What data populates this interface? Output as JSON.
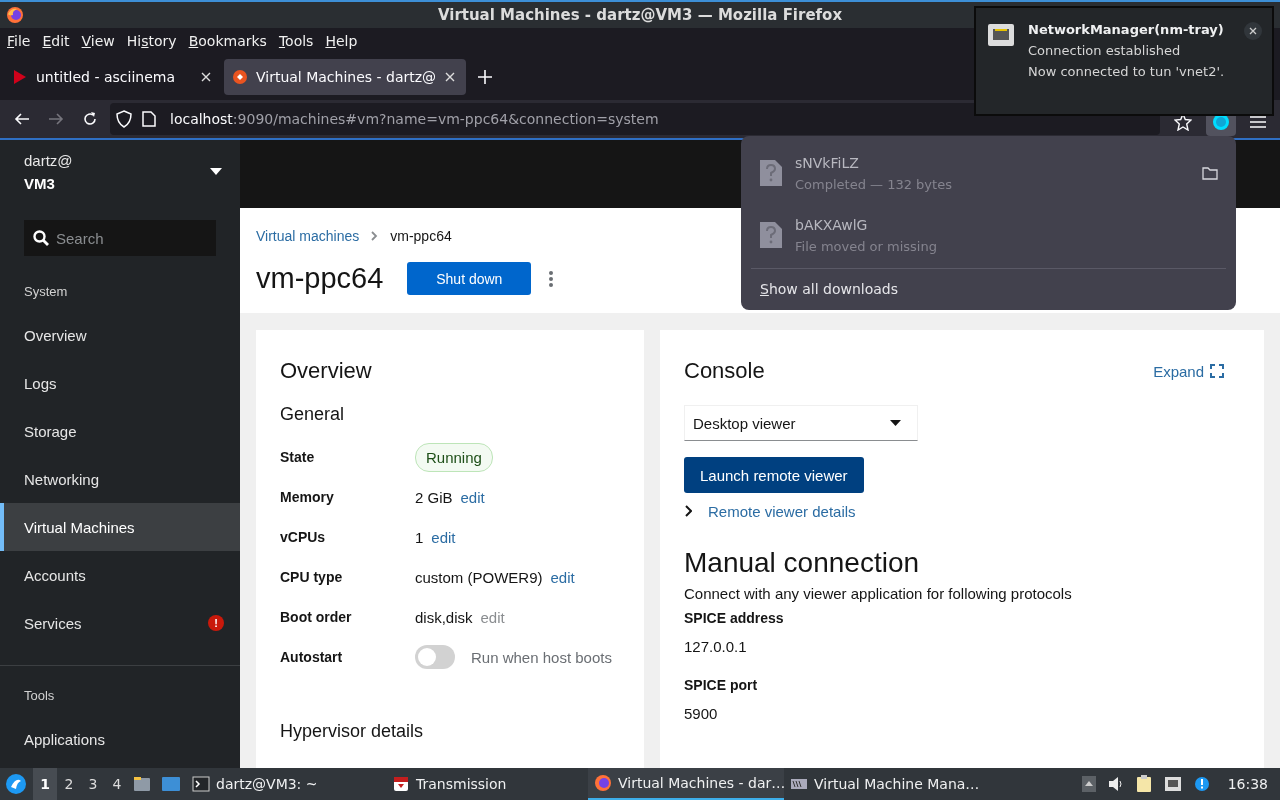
{
  "window": {
    "title": "Virtual Machines - dartz@VM3 — Mozilla Firefox"
  },
  "menu": [
    {
      "key": "F",
      "post": "ile"
    },
    {
      "key": "E",
      "post": "dit"
    },
    {
      "key": "V",
      "post": "iew"
    },
    {
      "pre": "Hi",
      "key": "s",
      "post": "tory"
    },
    {
      "key": "B",
      "post": "ookmarks"
    },
    {
      "key": "T",
      "post": "ools"
    },
    {
      "key": "H",
      "post": "elp"
    }
  ],
  "tabs": [
    {
      "title": "untitled - asciinema",
      "selected": false
    },
    {
      "title": "Virtual Machines - dartz@",
      "selected": true
    }
  ],
  "address": {
    "host": "localhost",
    "path": ":9090/machines#vm?name=vm-ppc64&connection=system"
  },
  "notification": {
    "app": "NetworkManager(nm-tray)",
    "summary": "Connection established",
    "body": "Now connected to tun 'vnet2'."
  },
  "downloads": {
    "items": [
      {
        "name": "sNVkFiLZ",
        "status": "Completed — 132 bytes",
        "folder": true
      },
      {
        "name": "bAKXAwlG",
        "status": "File moved or missing",
        "folder": false
      }
    ],
    "show_all": {
      "key": "S",
      "post": "how all downloads"
    }
  },
  "sidebar": {
    "user": "dartz@",
    "host": "VM3",
    "search": {
      "placeholder": "Search"
    },
    "sections": [
      {
        "title": "System",
        "items": [
          {
            "label": "Overview",
            "selected": false
          },
          {
            "label": "Logs",
            "selected": false
          },
          {
            "label": "Storage",
            "selected": false
          },
          {
            "label": "Networking",
            "selected": false
          },
          {
            "label": "Virtual Machines",
            "selected": true
          },
          {
            "label": "Accounts",
            "selected": false
          },
          {
            "label": "Services",
            "selected": false,
            "badge": "!"
          }
        ]
      },
      {
        "title": "Tools",
        "items": [
          {
            "label": "Applications",
            "selected": false
          }
        ]
      }
    ]
  },
  "page": {
    "breadcrumb": [
      {
        "label": "Virtual machines",
        "link": true
      },
      {
        "label": "vm-ppc64",
        "link": false
      }
    ],
    "title": "vm-ppc64",
    "primary_action": "Shut down"
  },
  "overview": {
    "title": "Overview",
    "section": "General",
    "rows": [
      {
        "kind": "status",
        "label": "State",
        "value": "Running"
      },
      {
        "kind": "value",
        "label": "Memory",
        "value": "2 GiB",
        "edit": "edit",
        "edit_disabled": false
      },
      {
        "kind": "value",
        "label": "vCPUs",
        "value": "1",
        "edit": "edit",
        "edit_disabled": false
      },
      {
        "kind": "value",
        "label": "CPU type",
        "value": "custom (POWER9)",
        "edit": "edit",
        "edit_disabled": false
      },
      {
        "kind": "value",
        "label": "Boot order",
        "value": "disk,disk",
        "edit": "edit",
        "edit_disabled": true
      },
      {
        "kind": "toggle",
        "label": "Autostart",
        "on": false,
        "text": "Run when host boots"
      }
    ],
    "next_section": "Hypervisor details"
  },
  "console": {
    "title": "Console",
    "expand": "Expand",
    "viewer": "Desktop viewer",
    "launch": "Launch remote viewer",
    "details": {
      "label": "Remote viewer details",
      "expanded": false
    },
    "manual_title": "Manual connection",
    "manual_text": "Connect with any viewer application for following protocols",
    "fields": [
      {
        "label": "SPICE address",
        "value": "127.0.0.1"
      },
      {
        "label": "SPICE port",
        "value": "5900"
      }
    ]
  },
  "taskbar": {
    "workspaces": [
      {
        "label": "1",
        "selected": true
      },
      {
        "label": "2",
        "selected": false
      },
      {
        "label": "3",
        "selected": false
      },
      {
        "label": "4",
        "selected": false
      }
    ],
    "tasks": [
      {
        "label": "dartz@VM3: ~",
        "selected": false
      },
      {
        "label": "Transmission",
        "selected": false
      },
      {
        "label": "Virtual Machines - dar…",
        "selected": true
      },
      {
        "label": "Virtual Machine Mana…",
        "selected": false
      }
    ],
    "clock": "16:38"
  }
}
